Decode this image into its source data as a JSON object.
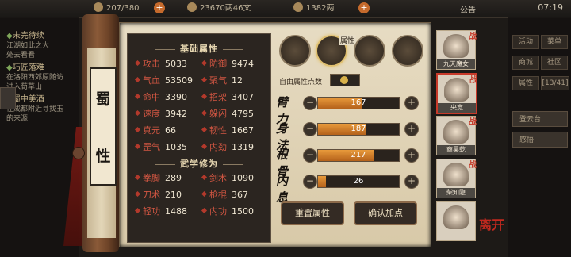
{
  "topbar": {
    "stamina": "207/380",
    "money": "23670两46文",
    "gold": "1382两",
    "announcement": "公告",
    "time": "07:19"
  },
  "quests": [
    {
      "title": "未完待续",
      "text": [
        "江湖如此之大",
        "处去看看"
      ]
    },
    {
      "title": "巧匠落难",
      "text": [
        "在洛阳西郊原随访",
        "进入荀草山"
      ]
    },
    {
      "title": "蜀中美酒",
      "text": [
        "在成都附近寻找玉",
        "的来源"
      ]
    }
  ],
  "scroll_title": [
    "蜀",
    "性"
  ],
  "basic_attrs": {
    "title": "基础属性",
    "items": [
      {
        "label": "攻击",
        "value": "5033"
      },
      {
        "label": "防御",
        "value": "9474"
      },
      {
        "label": "气血",
        "value": "53509"
      },
      {
        "label": "聚气",
        "value": "12"
      },
      {
        "label": "命中",
        "value": "3390"
      },
      {
        "label": "招架",
        "value": "3407"
      },
      {
        "label": "速度",
        "value": "3942"
      },
      {
        "label": "躲闪",
        "value": "4795"
      },
      {
        "label": "真元",
        "value": "66"
      },
      {
        "label": "韧性",
        "value": "1667"
      },
      {
        "label": "罡气",
        "value": "1035"
      },
      {
        "label": "内劲",
        "value": "1319"
      }
    ]
  },
  "martial_attrs": {
    "title": "武学修为",
    "items": [
      {
        "label": "拳脚",
        "value": "289"
      },
      {
        "label": "剑术",
        "value": "1090"
      },
      {
        "label": "刀术",
        "value": "210"
      },
      {
        "label": "枪棍",
        "value": "367"
      },
      {
        "label": "轻功",
        "value": "1488"
      },
      {
        "label": "内功",
        "value": "1500"
      }
    ]
  },
  "tabs": {
    "tab2_mark": "属性"
  },
  "free_points": {
    "label": "自由属性点数",
    "value": "0"
  },
  "stats": [
    {
      "char": "臂力",
      "value": "167",
      "progress": 0.55
    },
    {
      "char": "身法",
      "value": "187",
      "progress": 0.6
    },
    {
      "char": "根骨",
      "value": "217",
      "progress": 0.7
    },
    {
      "char": "内息",
      "value": "26",
      "progress": 0.1
    }
  ],
  "buttons": {
    "reset": "重置属性",
    "confirm": "确认加点",
    "leave": "离开"
  },
  "roster": [
    {
      "name": "九天魔女",
      "badge": "战",
      "selected": false
    },
    {
      "name": "央宽",
      "badge": "战",
      "selected": true
    },
    {
      "name": "商昊乾",
      "badge": "战",
      "selected": false
    },
    {
      "name": "柴知隐",
      "badge": "战",
      "selected": false
    },
    {
      "name": "",
      "badge": "",
      "selected": false
    }
  ],
  "right_menu": {
    "items": [
      "活动",
      "菜单",
      "商城",
      "社区",
      "属性"
    ],
    "level": "[13/41]",
    "long1": "登云台",
    "long2": "感悟"
  },
  "colors": {
    "accent": "#b3392b",
    "bar": "#e89a3b",
    "parchment": "#e7dcc3"
  }
}
